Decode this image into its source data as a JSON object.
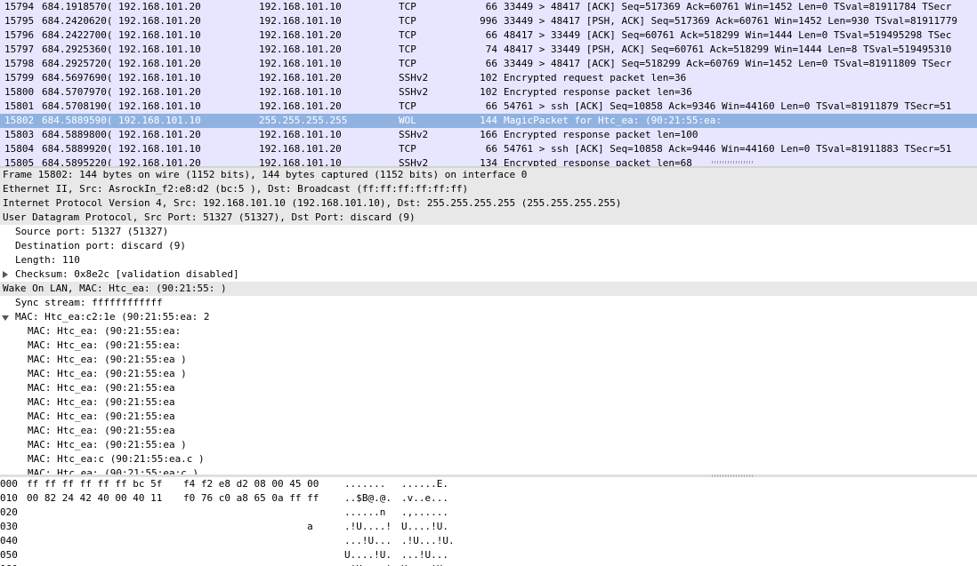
{
  "packet_list": {
    "rows": [
      {
        "no": "15794",
        "time": "684.1918570(",
        "src": "192.168.101.20",
        "dst": "192.168.101.10",
        "proto": "TCP",
        "len": "66",
        "info": "33449 > 48417 [ACK] Seq=517369 Ack=60761 Win=1452 Len=0 TSval=81911784 TSecr",
        "selected": false
      },
      {
        "no": "15795",
        "time": "684.2420620(",
        "src": "192.168.101.20",
        "dst": "192.168.101.10",
        "proto": "TCP",
        "len": "996",
        "info": "33449 > 48417 [PSH, ACK] Seq=517369 Ack=60761 Win=1452 Len=930 TSval=81911779",
        "selected": false
      },
      {
        "no": "15796",
        "time": "684.2422700(",
        "src": "192.168.101.10",
        "dst": "192.168.101.20",
        "proto": "TCP",
        "len": "66",
        "info": "48417 > 33449 [ACK] Seq=60761 Ack=518299 Win=1444 Len=0 TSval=519495298 TSec",
        "selected": false
      },
      {
        "no": "15797",
        "time": "684.2925360(",
        "src": "192.168.101.10",
        "dst": "192.168.101.20",
        "proto": "TCP",
        "len": "74",
        "info": "48417 > 33449 [PSH, ACK] Seq=60761 Ack=518299 Win=1444 Len=8 TSval=519495310",
        "selected": false
      },
      {
        "no": "15798",
        "time": "684.2925720(",
        "src": "192.168.101.20",
        "dst": "192.168.101.10",
        "proto": "TCP",
        "len": "66",
        "info": "33449 > 48417 [ACK] Seq=518299 Ack=60769 Win=1452 Len=0 TSval=81911809 TSecr",
        "selected": false
      },
      {
        "no": "15799",
        "time": "684.5697690(",
        "src": "192.168.101.10",
        "dst": "192.168.101.20",
        "proto": "SSHv2",
        "len": "102",
        "info": "Encrypted request packet len=36",
        "selected": false
      },
      {
        "no": "15800",
        "time": "684.5707970(",
        "src": "192.168.101.20",
        "dst": "192.168.101.10",
        "proto": "SSHv2",
        "len": "102",
        "info": "Encrypted response packet len=36",
        "selected": false
      },
      {
        "no": "15801",
        "time": "684.5708190(",
        "src": "192.168.101.10",
        "dst": "192.168.101.20",
        "proto": "TCP",
        "len": "66",
        "info": "54761 > ssh [ACK] Seq=10858 Ack=9346 Win=44160 Len=0 TSval=81911879 TSecr=51",
        "selected": false
      },
      {
        "no": "15802",
        "time": "684.5889590(",
        "src": "192.168.101.10",
        "dst": "255.255.255.255",
        "proto": "WOL",
        "len": "144",
        "info": "MagicPacket for Htc_ea:      (90:21:55:ea:",
        "selected": true
      },
      {
        "no": "15803",
        "time": "684.5889800(",
        "src": "192.168.101.20",
        "dst": "192.168.101.10",
        "proto": "SSHv2",
        "len": "166",
        "info": "Encrypted response packet len=100",
        "selected": false
      },
      {
        "no": "15804",
        "time": "684.5889920(",
        "src": "192.168.101.10",
        "dst": "192.168.101.20",
        "proto": "TCP",
        "len": "66",
        "info": "54761 > ssh [ACK] Seq=10858 Ack=9446 Win=44160 Len=0 TSval=81911883 TSecr=51",
        "selected": false
      },
      {
        "no": "15805",
        "time": "684.5895220(",
        "src": "192.168.101.20",
        "dst": "192.168.101.10",
        "proto": "SSHv2",
        "len": "134",
        "info": "Encrypted response packet len=68",
        "selected": false
      }
    ]
  },
  "details": {
    "rows": [
      {
        "level": 0,
        "hdr": true,
        "expander": "none",
        "text": "Frame 15802: 144 bytes on wire (1152 bits), 144 bytes captured (1152 bits) on interface 0"
      },
      {
        "level": 0,
        "hdr": true,
        "expander": "none",
        "text": "Ethernet II, Src: AsrockIn_f2:e8:d2 (bc:5             ), Dst: Broadcast (ff:ff:ff:ff:ff:ff)"
      },
      {
        "level": 0,
        "hdr": true,
        "expander": "none",
        "text": "Internet Protocol Version 4, Src: 192.168.101.10 (192.168.101.10), Dst: 255.255.255.255 (255.255.255.255)"
      },
      {
        "level": 0,
        "hdr": true,
        "expander": "none",
        "text": "User Datagram Protocol, Src Port: 51327 (51327), Dst Port: discard (9)"
      },
      {
        "level": 1,
        "hdr": false,
        "expander": "none",
        "text": "Source port: 51327 (51327)"
      },
      {
        "level": 1,
        "hdr": false,
        "expander": "none",
        "text": "Destination port: discard (9)"
      },
      {
        "level": 1,
        "hdr": false,
        "expander": "none",
        "text": "Length: 110"
      },
      {
        "level": 1,
        "hdr": false,
        "expander": "right",
        "text": "Checksum: 0x8e2c [validation disabled]"
      },
      {
        "level": 0,
        "hdr": true,
        "expander": "none",
        "text": "Wake On LAN, MAC: Htc_ea:     (90:21:55:        )"
      },
      {
        "level": 1,
        "hdr": false,
        "expander": "none",
        "text": "Sync stream: ffffffffffff"
      },
      {
        "level": 1,
        "hdr": false,
        "expander": "down",
        "text": "MAC: Htc_ea:c2:1e (90:21:55:ea: 2"
      },
      {
        "level": 2,
        "hdr": false,
        "expander": "none",
        "text": "MAC: Htc_ea:      (90:21:55:ea:"
      },
      {
        "level": 2,
        "hdr": false,
        "expander": "none",
        "text": "MAC: Htc_ea:      (90:21:55:ea:"
      },
      {
        "level": 2,
        "hdr": false,
        "expander": "none",
        "text": "MAC: Htc_ea:      (90:21:55:ea      )"
      },
      {
        "level": 2,
        "hdr": false,
        "expander": "none",
        "text": "MAC: Htc_ea:      (90:21:55:ea      )"
      },
      {
        "level": 2,
        "hdr": false,
        "expander": "none",
        "text": "MAC: Htc_ea:      (90:21:55:ea"
      },
      {
        "level": 2,
        "hdr": false,
        "expander": "none",
        "text": "MAC: Htc_ea:      (90:21:55:ea"
      },
      {
        "level": 2,
        "hdr": false,
        "expander": "none",
        "text": "MAC: Htc_ea:      (90:21:55:ea"
      },
      {
        "level": 2,
        "hdr": false,
        "expander": "none",
        "text": "MAC: Htc_ea:      (90:21:55:ea"
      },
      {
        "level": 2,
        "hdr": false,
        "expander": "none",
        "text": "MAC: Htc_ea:      (90:21:55:ea      )"
      },
      {
        "level": 2,
        "hdr": false,
        "expander": "none",
        "text": "MAC: Htc_ea:c     (90:21:55:ea.c    )"
      },
      {
        "level": 2,
        "hdr": false,
        "expander": "none",
        "text": "MAC: Htc_ea:      (90:21:55:ea:c    )"
      }
    ]
  },
  "hex": {
    "rows": [
      {
        "off": "000",
        "b1": "ff ff ff ff ff ff bc 5f",
        "b2": "f4 f2 e8 d2 08 00 45 00",
        "a1": ".......",
        "a2": "......E."
      },
      {
        "off": "010",
        "b1": "00 82 24 42 40 00 40 11",
        "b2": "f0 76 c0 a8 65 0a ff ff",
        "a1": "..$B@.@.",
        "a2": ".v..e..."
      },
      {
        "off": "020",
        "b1": "",
        "b2": "",
        "a1": "......n",
        "a2": ".,......"
      },
      {
        "off": "030",
        "b1": "",
        "b2": "                     a",
        "a1": ".!U....!",
        "a2": "U....!U."
      },
      {
        "off": "040",
        "b1": "",
        "b2": "",
        "a1": "...!U...",
        "a2": ".!U...!U."
      },
      {
        "off": "050",
        "b1": "",
        "b2": "",
        "a1": "U....!U.",
        "a2": "...!U..."
      },
      {
        "off": "060",
        "b1": "",
        "b2": "",
        "a1": ".!U....!",
        "a2": "U....!U."
      }
    ]
  },
  "colors": {
    "list_bg": "#e7e6ff",
    "selected_bg": "#8fb2e1",
    "detail_hdr_bg": "#e8e8e8"
  }
}
